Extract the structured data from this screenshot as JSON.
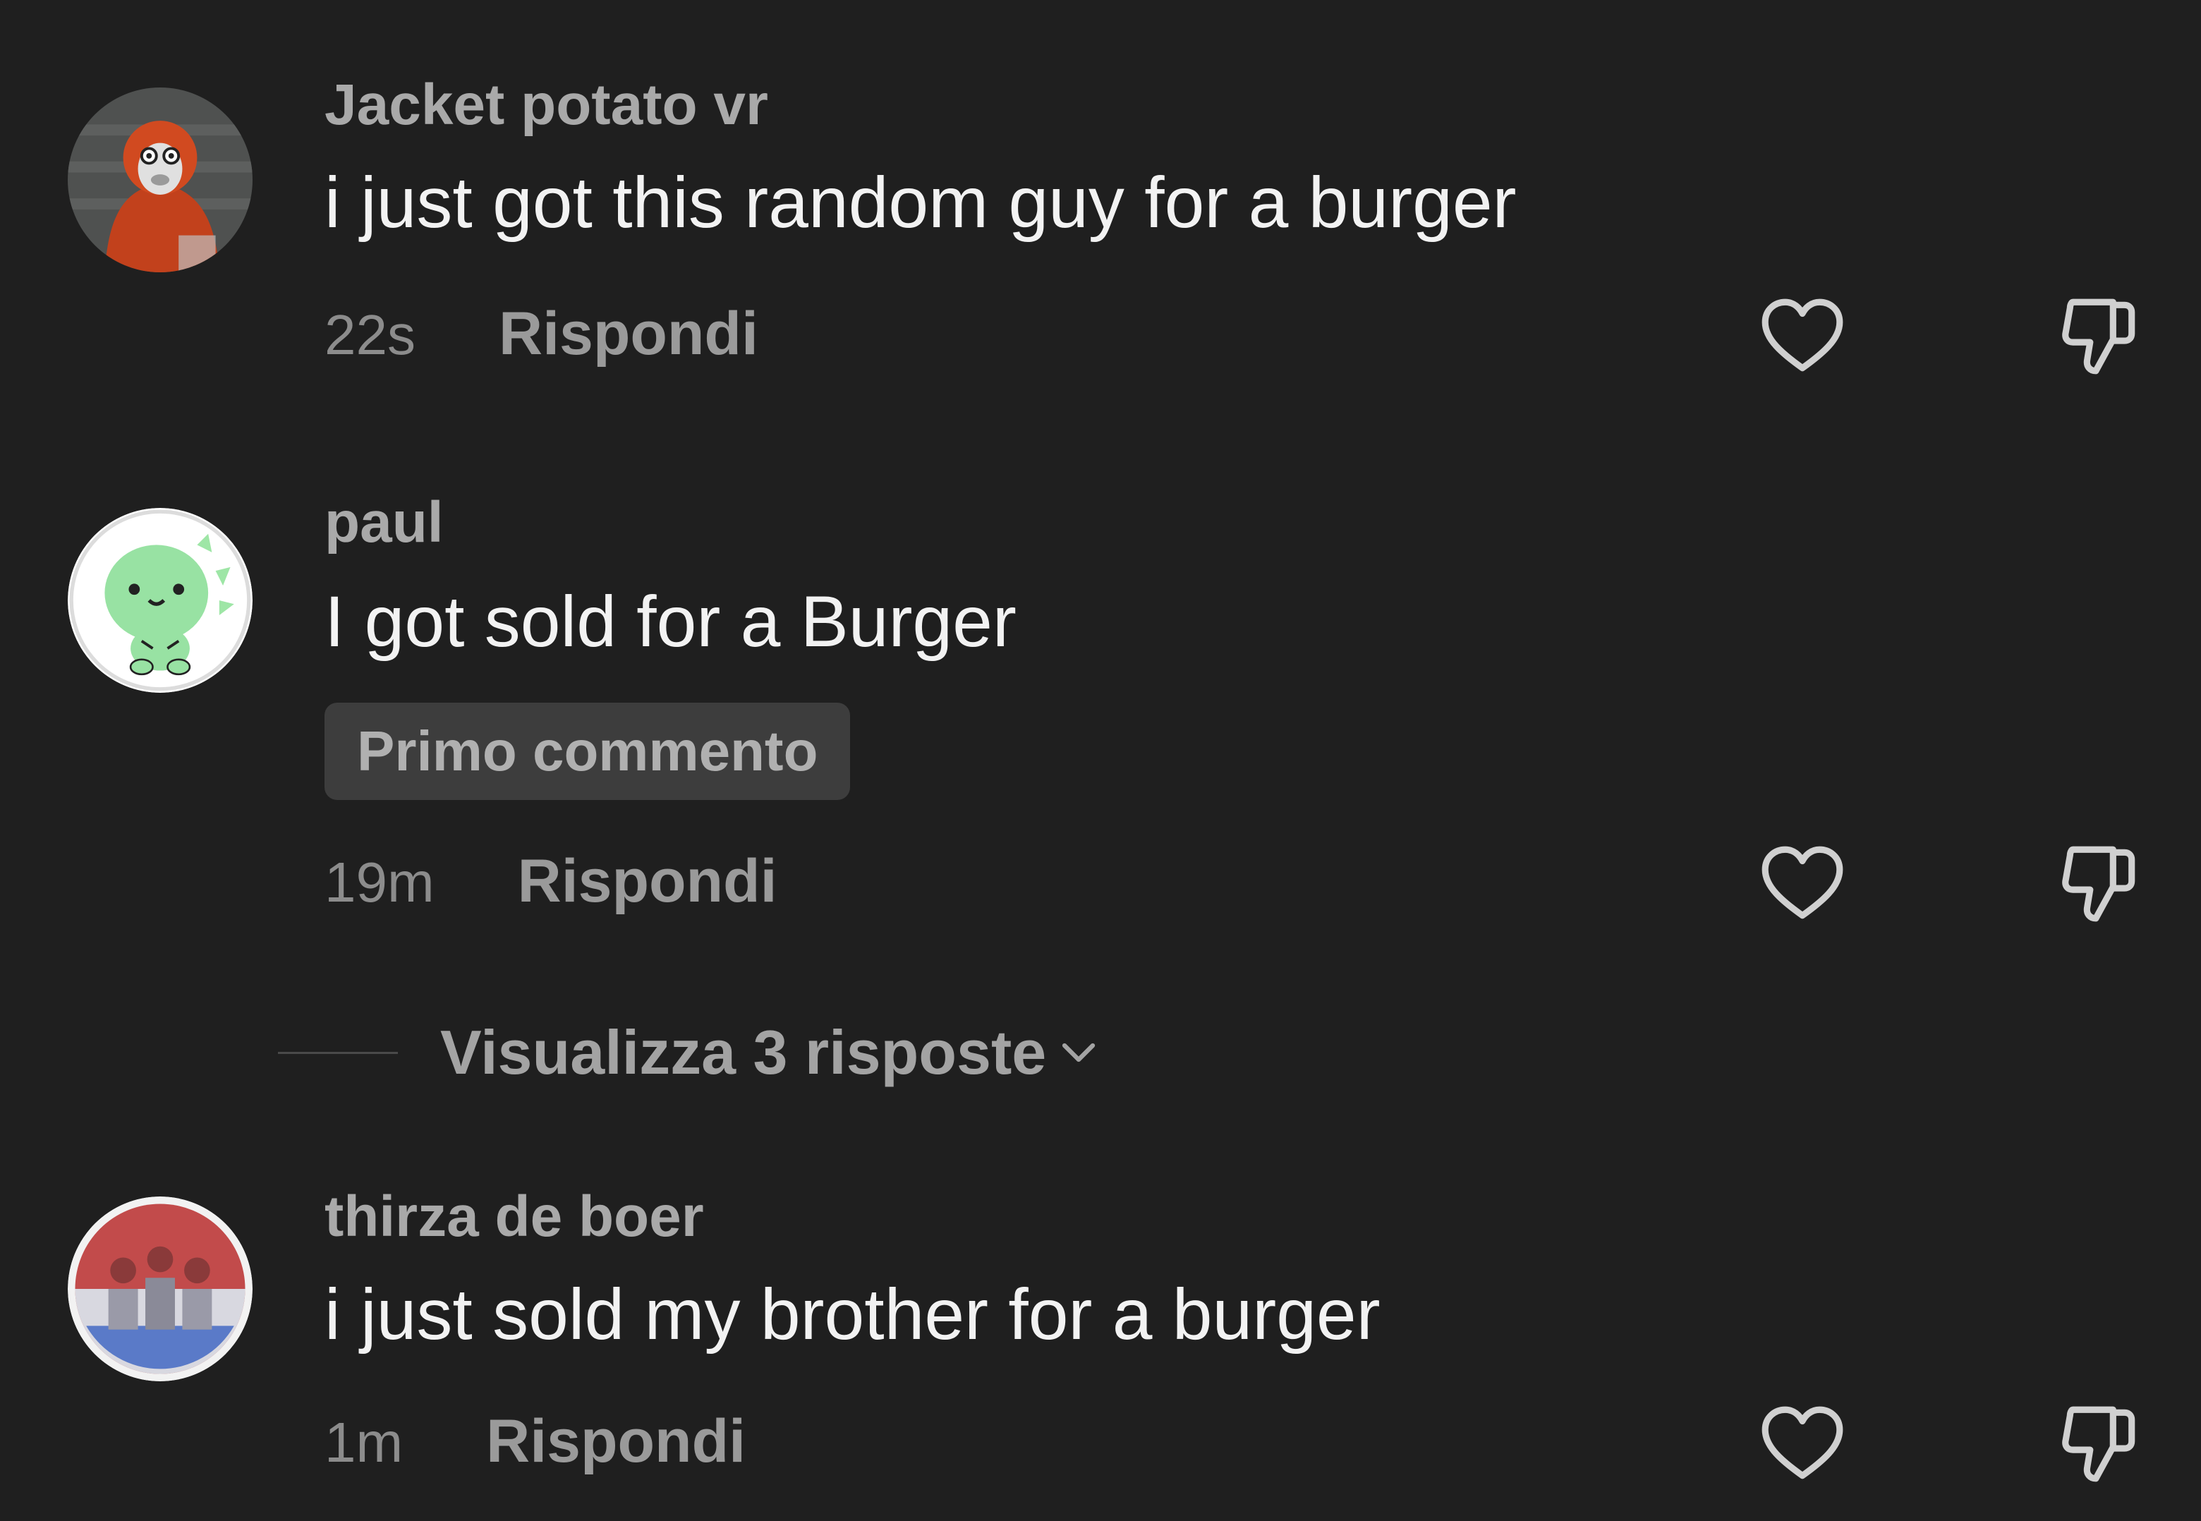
{
  "comments": [
    {
      "username": "Jacket potato vr",
      "text": "i just got this random guy for a burger",
      "time": "22s",
      "reply_label": "Rispondi",
      "avatar_icon": "gorilla-avatar"
    },
    {
      "username": "paul",
      "text": "I got sold for a Burger",
      "badge": "Primo commento",
      "time": "19m",
      "reply_label": "Rispondi",
      "avatar_icon": "green-dino-avatar",
      "view_replies_label": "Visualizza 3 risposte"
    },
    {
      "username": "thirza de boer",
      "text": "i just sold my brother for a burger",
      "time": "1m",
      "reply_label": "Rispondi",
      "avatar_icon": "group-photo-avatar"
    }
  ],
  "icons": {
    "like": "heart-icon",
    "dislike": "thumbs-down-icon",
    "expand": "chevron-down-icon"
  },
  "colors": {
    "background": "#1f1f1f",
    "username": "#a9a9a9",
    "text": "#f2f2f2",
    "badge_bg": "#3d3d3d"
  }
}
